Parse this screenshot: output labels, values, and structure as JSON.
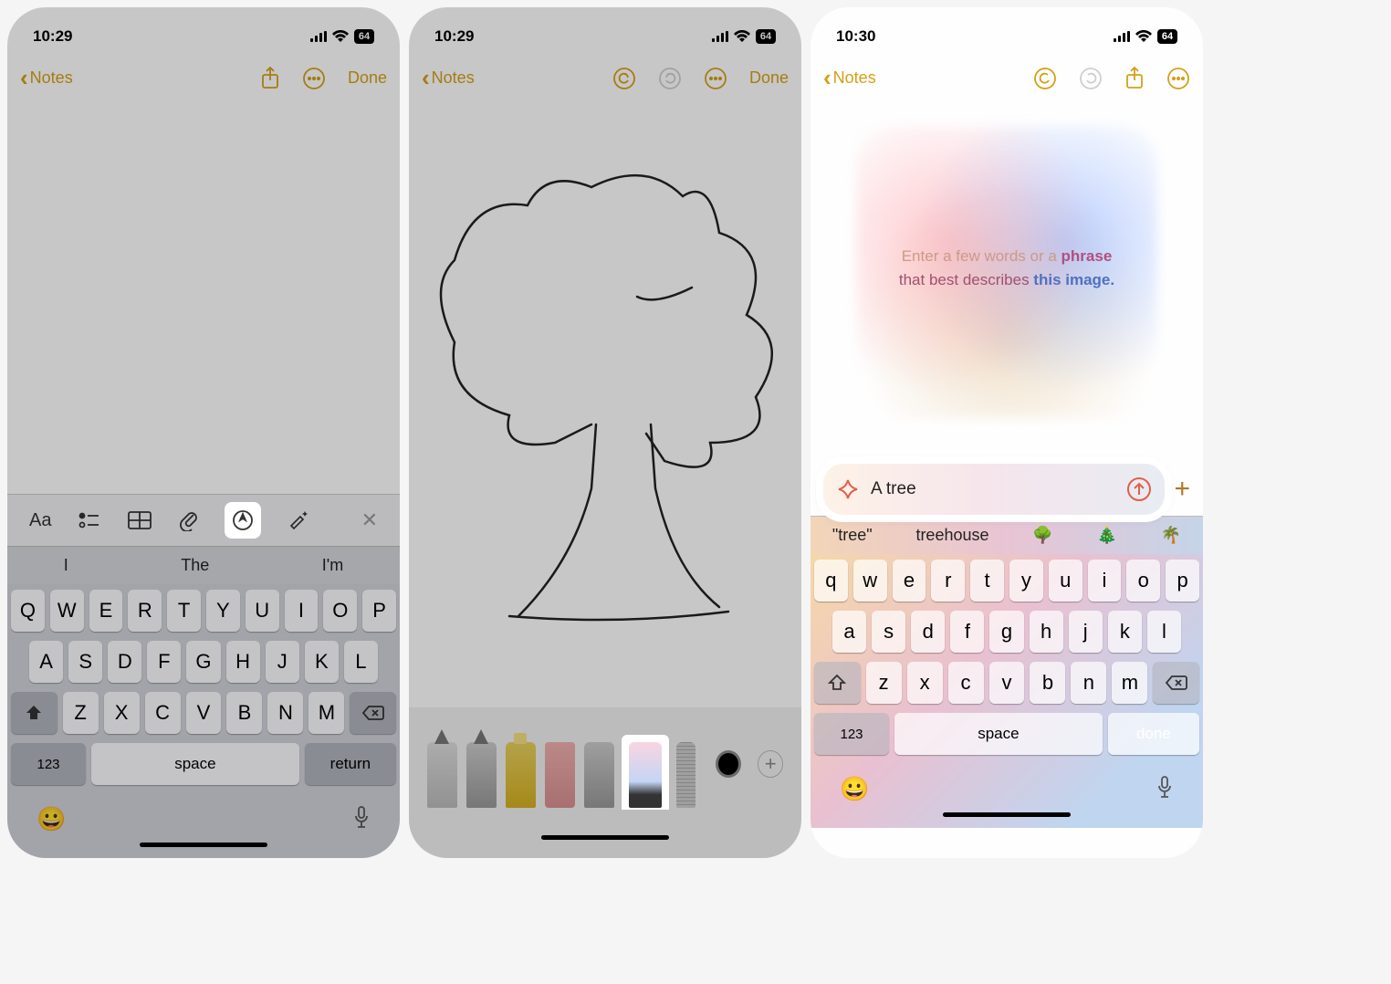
{
  "screen1": {
    "time": "10:29",
    "battery": "64",
    "back_label": "Notes",
    "done_label": "Done",
    "toolbar": [
      "Aa",
      "list",
      "table",
      "attach",
      "markup",
      "wand",
      "x"
    ],
    "suggestions": [
      "I",
      "The",
      "I'm"
    ],
    "kbd_r1": [
      "Q",
      "W",
      "E",
      "R",
      "T",
      "Y",
      "U",
      "I",
      "O",
      "P"
    ],
    "kbd_r2": [
      "A",
      "S",
      "D",
      "F",
      "G",
      "H",
      "J",
      "K",
      "L"
    ],
    "kbd_r3_mid": [
      "Z",
      "X",
      "C",
      "V",
      "B",
      "N",
      "M"
    ],
    "kbd_123": "123",
    "kbd_space": "space",
    "kbd_return": "return"
  },
  "screen2": {
    "time": "10:29",
    "battery": "64",
    "back_label": "Notes",
    "done_label": "Done"
  },
  "screen3": {
    "time": "10:30",
    "battery": "64",
    "back_label": "Notes",
    "halo_l1a": "Enter a ",
    "halo_l1b": "few words or a ",
    "halo_l1c": "phrase",
    "halo_l2a": "that best ",
    "halo_l2b": "describes ",
    "halo_l2c": "this image.",
    "prompt_text": "A tree",
    "suggestions": [
      "\"tree\"",
      "treehouse"
    ],
    "kbd_r1": [
      "q",
      "w",
      "e",
      "r",
      "t",
      "y",
      "u",
      "i",
      "o",
      "p"
    ],
    "kbd_r2": [
      "a",
      "s",
      "d",
      "f",
      "g",
      "h",
      "j",
      "k",
      "l"
    ],
    "kbd_r3_mid": [
      "z",
      "x",
      "c",
      "v",
      "b",
      "n",
      "m"
    ],
    "kbd_123": "123",
    "kbd_space": "space",
    "kbd_done": "done"
  }
}
